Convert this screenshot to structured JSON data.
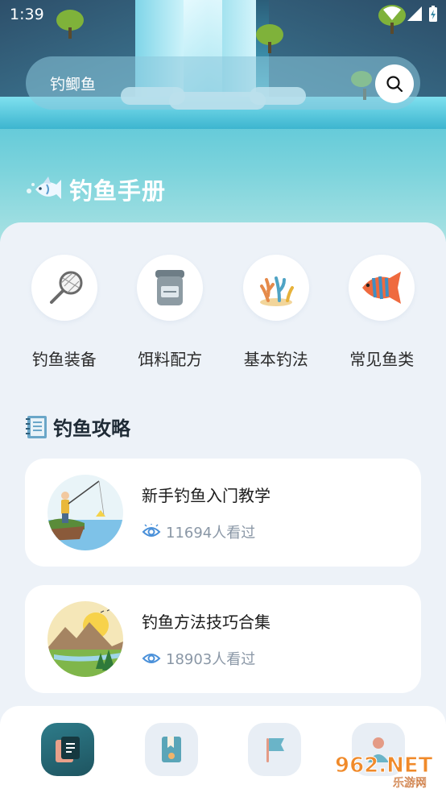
{
  "status_bar": {
    "time": "1:39"
  },
  "search": {
    "placeholder": "钓鲫鱼"
  },
  "app": {
    "title": "钓鱼手册"
  },
  "categories": [
    {
      "label": "钓鱼装备",
      "icon": "fishing-net-icon"
    },
    {
      "label": "饵料配方",
      "icon": "bait-jar-icon"
    },
    {
      "label": "基本钓法",
      "icon": "coral-icon"
    },
    {
      "label": "常见鱼类",
      "icon": "fish-icon"
    }
  ],
  "section": {
    "title": "钓鱼攻略",
    "icon": "notebook-icon"
  },
  "guides": [
    {
      "title": "新手钓鱼入门教学",
      "views": "11694人看过",
      "thumb": "angler-by-lake-thumbnail"
    },
    {
      "title": "钓鱼方法技巧合集",
      "views": "18903人看过",
      "thumb": "mountain-landscape-thumbnail"
    }
  ],
  "bottom_nav": [
    {
      "icon": "book-icon",
      "active": true
    },
    {
      "icon": "bookmark-icon",
      "active": false
    },
    {
      "icon": "flag-icon",
      "active": false
    },
    {
      "icon": "profile-icon",
      "active": false
    }
  ],
  "watermark": {
    "text": "962.NET",
    "subtext": "乐游网"
  },
  "colors": {
    "accent": "#2e7c8a",
    "view_icon": "#4a90d9",
    "background": "#edf2f8"
  }
}
